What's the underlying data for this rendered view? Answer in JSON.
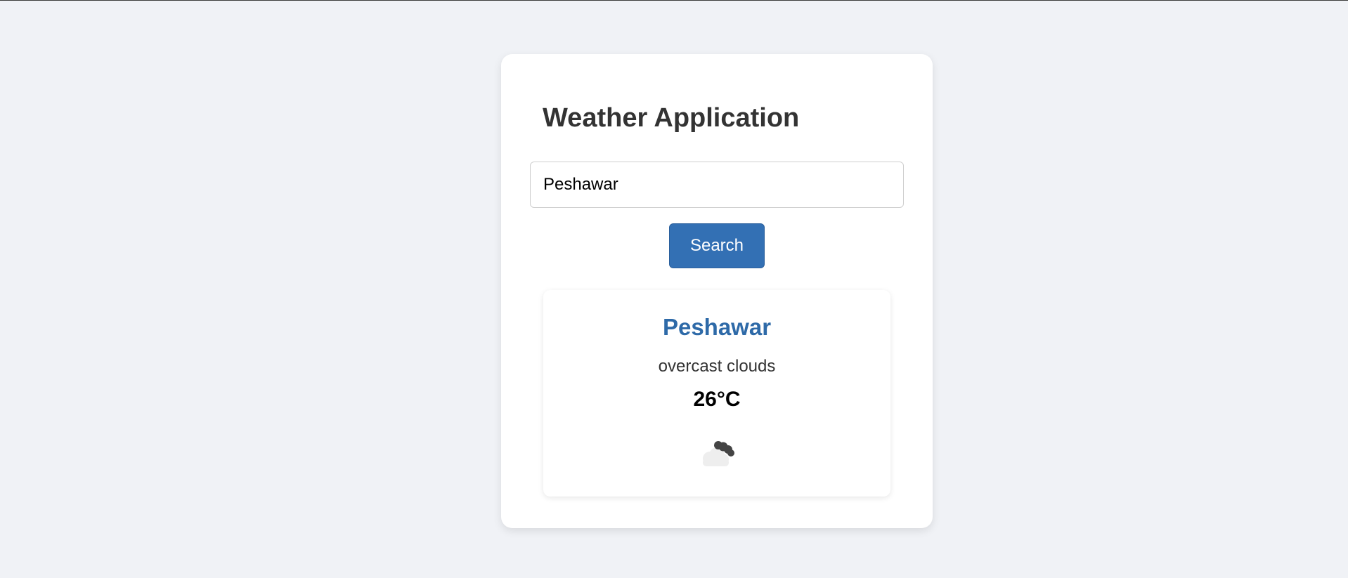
{
  "app": {
    "title": "Weather Application"
  },
  "search": {
    "value": "Peshawar",
    "button_label": "Search"
  },
  "result": {
    "city": "Peshawar",
    "description": "overcast clouds",
    "temperature": "26°C",
    "icon": "overcast-clouds-icon"
  }
}
